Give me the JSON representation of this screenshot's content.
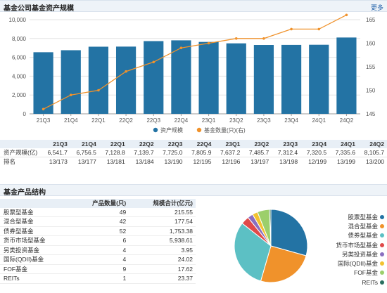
{
  "section1": {
    "title": "基金公司基金资产规模",
    "more": "更多"
  },
  "section2": {
    "title": "基金产品结构"
  },
  "chart_data": {
    "type": "bar",
    "categories": [
      "21Q3",
      "21Q4",
      "22Q1",
      "22Q2",
      "22Q3",
      "22Q4",
      "23Q1",
      "23Q2",
      "23Q3",
      "23Q4",
      "24Q1",
      "24Q2"
    ],
    "series": [
      {
        "name": "资产规模",
        "type": "bar",
        "axis": "left",
        "color": "#2373a4",
        "values": [
          6541.7,
          6756.5,
          7128.8,
          7139.7,
          7725.0,
          7805.9,
          7637.2,
          7485.7,
          7312.4,
          7320.5,
          7335.6,
          8105.7
        ]
      },
      {
        "name": "基金数量(只)(右)",
        "type": "line",
        "axis": "right",
        "color": "#f0922b",
        "values": [
          146,
          149,
          150,
          154,
          156,
          159,
          160,
          161,
          161,
          163,
          163,
          166
        ]
      }
    ],
    "ylim_left": [
      0,
      10000
    ],
    "left_ticks": [
      "0",
      "2,000",
      "4,000",
      "6,000",
      "8,000",
      "10,000"
    ],
    "ylim_right": [
      145,
      165
    ],
    "right_ticks": [
      "145",
      "150",
      "155",
      "160",
      "165"
    ],
    "legend_position": "bottom",
    "grid": true
  },
  "stats_table": {
    "header": [
      "",
      "21Q3",
      "21Q4",
      "22Q1",
      "22Q2",
      "22Q3",
      "22Q4",
      "23Q1",
      "23Q2",
      "23Q3",
      "23Q4",
      "24Q1",
      "24Q2"
    ],
    "rows": [
      [
        "资产规模(亿)",
        "6,541.7",
        "6,756.5",
        "7,128.8",
        "7,139.7",
        "7,725.0",
        "7,805.9",
        "7,637.2",
        "7,485.7",
        "7,312.4",
        "7,320.5",
        "7,335.6",
        "8,105.7"
      ],
      [
        "排名",
        "13/173",
        "13/177",
        "13/181",
        "13/184",
        "13/190",
        "12/195",
        "12/196",
        "13/197",
        "13/198",
        "12/199",
        "13/199",
        "13/200"
      ]
    ]
  },
  "structure_table": {
    "header": [
      "",
      "产品数量(只)",
      "规模合计(亿元)"
    ],
    "rows": [
      [
        "股票型基金",
        "49",
        "215.55"
      ],
      [
        "混合型基金",
        "42",
        "177.54"
      ],
      [
        "债券型基金",
        "52",
        "1,753.38"
      ],
      [
        "货币市场型基金",
        "6",
        "5,938.61"
      ],
      [
        "另类投资基金",
        "4",
        "3.95"
      ],
      [
        "国际(QDII)基金",
        "4",
        "24.02"
      ],
      [
        "FOF基金",
        "9",
        "17.62"
      ],
      [
        "REITs",
        "1",
        "23.37"
      ]
    ]
  },
  "pie": {
    "type": "pie",
    "labels": [
      "股票型基金",
      "混合型基金",
      "债券型基金",
      "货币市场型基金",
      "另类投资基金",
      "国际(QDII)基金",
      "FOF基金",
      "REITs"
    ],
    "values": [
      49,
      42,
      52,
      6,
      4,
      4,
      9,
      1
    ],
    "colors": [
      "#2373a4",
      "#f0922b",
      "#5cc0c4",
      "#e04a4a",
      "#8a6fc0",
      "#f2c230",
      "#9ccf6b",
      "#2b6f5f"
    ]
  }
}
